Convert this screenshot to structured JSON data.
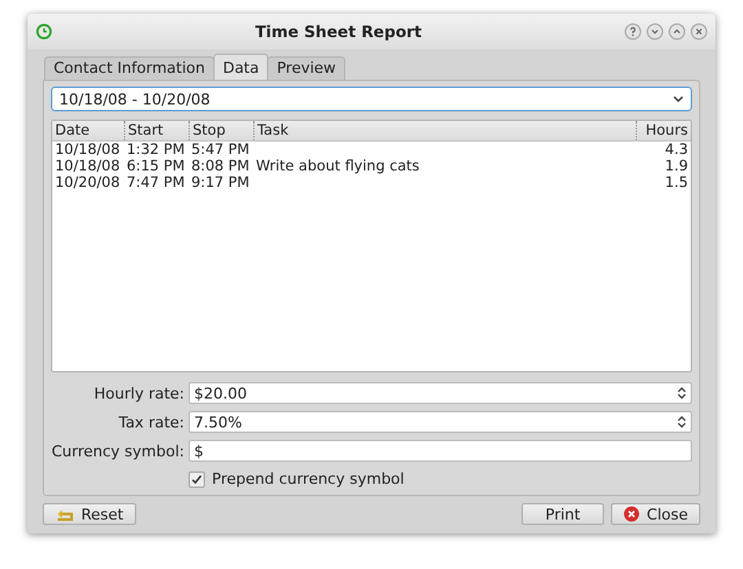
{
  "window": {
    "title": "Time Sheet Report"
  },
  "tabs": [
    {
      "label": "Contact Information",
      "selected": false
    },
    {
      "label": "Data",
      "selected": true
    },
    {
      "label": "Preview",
      "selected": false
    }
  ],
  "date_range": {
    "value": "10/18/08 - 10/20/08"
  },
  "table": {
    "columns": [
      "Date",
      "Start",
      "Stop",
      "Task",
      "Hours"
    ],
    "rows": [
      [
        "10/18/08",
        "1:32 PM",
        "5:47 PM",
        "",
        "4.3"
      ],
      [
        "10/18/08",
        "6:15 PM",
        "8:08 PM",
        "Write about flying cats",
        "1.9"
      ],
      [
        "10/20/08",
        "7:47 PM",
        "9:17 PM",
        "",
        "1.5"
      ]
    ]
  },
  "form": [
    {
      "kind": "spin",
      "label": "Hourly rate:",
      "value": "$20.00"
    },
    {
      "kind": "spin",
      "label": "Tax rate:",
      "value": "7.50%"
    },
    {
      "kind": "text",
      "label": "Currency symbol:",
      "value": "$"
    }
  ],
  "prepend": {
    "label": "Prepend currency symbol",
    "checked": true
  },
  "buttons": {
    "left": "Reset",
    "print": "Print",
    "close": "Close"
  }
}
